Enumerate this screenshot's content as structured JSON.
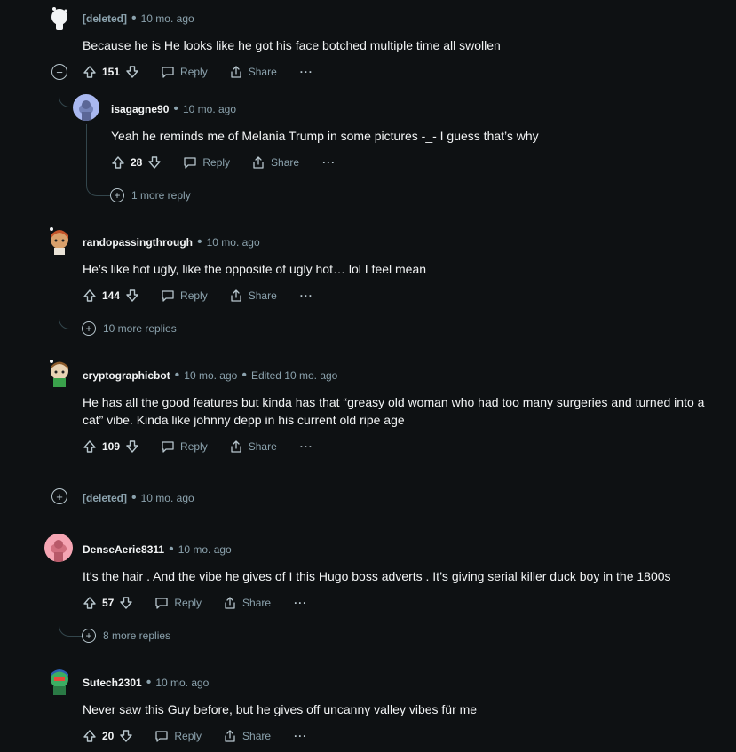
{
  "ui": {
    "reply_label": "Reply",
    "share_label": "Share",
    "more_dots": "···",
    "dot": "•"
  },
  "comments": [
    {
      "author": "[deleted]",
      "time": "10 mo. ago",
      "body": "Because he is He looks like he got his face botched multiple time all swollen",
      "votes": "151"
    },
    {
      "author": "isagagne90",
      "time": "10 mo. ago",
      "body": "Yeah he reminds me of Melania Trump in some pictures -_- I guess that’s why",
      "votes": "28",
      "more": "1 more reply"
    },
    {
      "author": "randopassingthrough",
      "time": "10 mo. ago",
      "body": "He’s like hot ugly, like the opposite of ugly hot… lol I feel mean",
      "votes": "144",
      "more": "10 more replies"
    },
    {
      "author": "cryptographicbot",
      "time": "10 mo. ago",
      "edited": "Edited 10 mo. ago",
      "body": "He has all the good features but kinda has that “greasy old woman who had too many surgeries and turned into a cat” vibe. Kinda like johnny depp in his current old ripe age",
      "votes": "109"
    },
    {
      "author": "[deleted]",
      "time": "10 mo. ago"
    },
    {
      "author": "DenseAerie8311",
      "time": "10 mo. ago",
      "body": "It’s the hair . And the vibe he gives of I this Hugo boss adverts . It’s giving serial killer duck boy in the 1800s",
      "votes": "57",
      "more": "8 more replies"
    },
    {
      "author": "Sutech2301",
      "time": "10 mo. ago",
      "body": "Never saw this Guy before, but he gives off uncanny valley vibes für me",
      "votes": "20"
    }
  ]
}
